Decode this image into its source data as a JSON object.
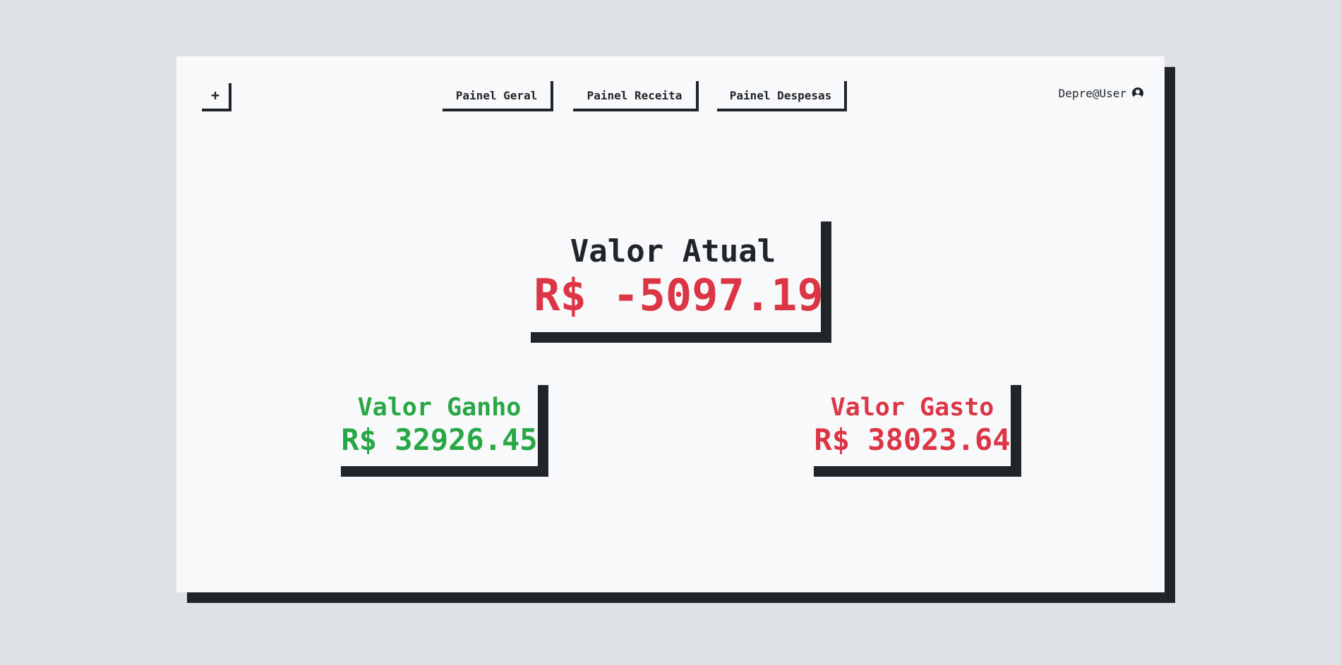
{
  "header": {
    "add_label": "+",
    "nav": [
      {
        "label": "Painel Geral"
      },
      {
        "label": "Painel Receita"
      },
      {
        "label": "Painel Despesas"
      }
    ],
    "user": {
      "name": "Depre@User",
      "icon": "user-circle-icon"
    }
  },
  "balance": {
    "title": "Valor Atual",
    "value": "R$ -5097.19",
    "color": "#dc3545"
  },
  "income": {
    "title": "Valor Ganho",
    "value": "R$ 32926.45",
    "color": "#28a745"
  },
  "expense": {
    "title": "Valor Gasto",
    "value": "R$ 38023.64",
    "color": "#dc3545"
  },
  "colors": {
    "background": "#dee2e6",
    "panel": "#f8f9fa",
    "shadow": "#212529",
    "positive": "#28a745",
    "negative": "#dc3545"
  }
}
